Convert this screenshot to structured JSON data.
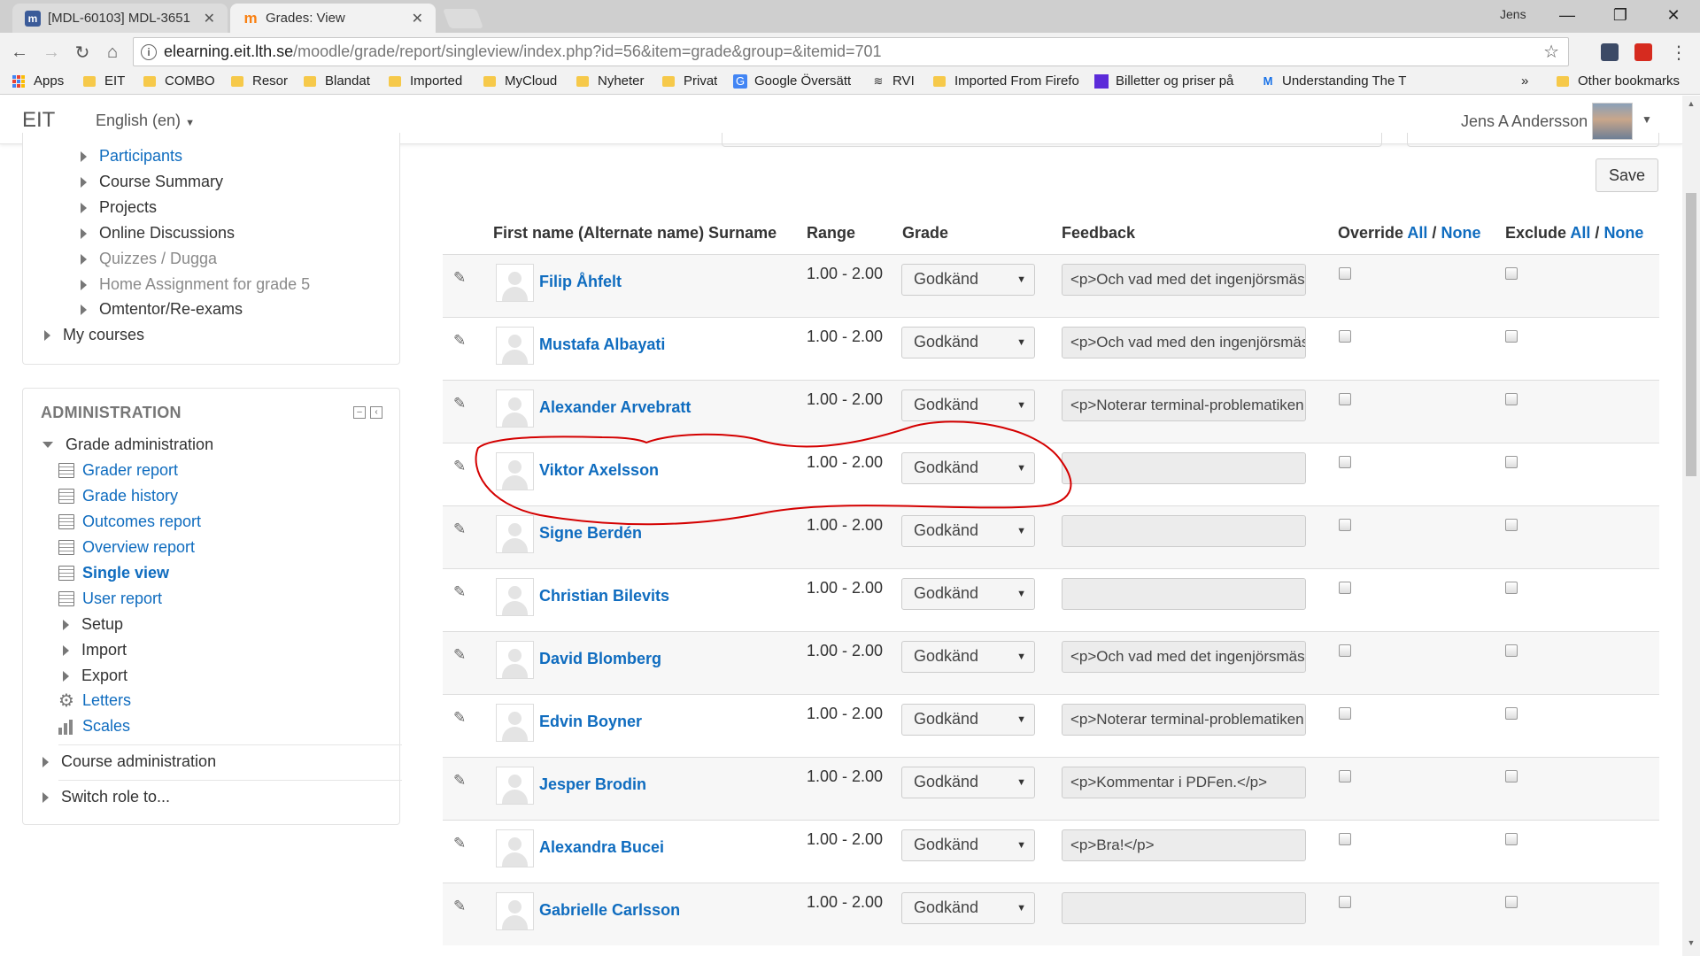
{
  "browser": {
    "tabs": [
      {
        "title": "[MDL-60103] MDL-3651",
        "favicon": "moodle-tracker-icon"
      },
      {
        "title": "Grades: View",
        "favicon": "moodle-icon"
      }
    ],
    "profile": "Jens",
    "url": {
      "host": "elearning.eit.lth.se",
      "path": "/moodle/grade/report/singleview/index.php?id=56&item=grade&group=&itemid=701"
    },
    "bookmarks": [
      "Apps",
      "EIT",
      "COMBO",
      "Resor",
      "Blandat",
      "Imported",
      "MyCloud",
      "Nyheter",
      "Privat",
      "Google Översätt",
      "RVI",
      "Imported From Firefo",
      "Billetter og priser på",
      "Understanding The T"
    ],
    "bookmarks_overflow": "»",
    "other_bookmarks": "Other bookmarks"
  },
  "navbar": {
    "brand": "EIT",
    "language": "English (en)",
    "user": "Jens A Andersson"
  },
  "navigation_block": {
    "items": [
      {
        "label": "Participants",
        "style": "link"
      },
      {
        "label": "Course Summary",
        "style": "dark"
      },
      {
        "label": "Projects",
        "style": "dark"
      },
      {
        "label": "Online Discussions",
        "style": "dark"
      },
      {
        "label": "Quizzes / Dugga",
        "style": "muted"
      },
      {
        "label": "Home Assignment for grade 5",
        "style": "muted"
      },
      {
        "label": "Omtentor/Re-exams",
        "style": "dark"
      }
    ],
    "my_courses": "My courses"
  },
  "admin_block": {
    "title": "ADMINISTRATION",
    "grade_admin": "Grade administration",
    "reports": [
      {
        "label": "Grader report",
        "bold": false
      },
      {
        "label": "Grade history",
        "bold": false
      },
      {
        "label": "Outcomes report",
        "bold": false
      },
      {
        "label": "Overview report",
        "bold": false
      },
      {
        "label": "Single view",
        "bold": true
      },
      {
        "label": "User report",
        "bold": false
      }
    ],
    "subsections": [
      "Setup",
      "Import",
      "Export"
    ],
    "letters": "Letters",
    "scales": "Scales",
    "course_admin": "Course administration",
    "switch_role": "Switch role to..."
  },
  "grades": {
    "save_label": "Save",
    "columns": {
      "name": "First name (Alternate name) Surname",
      "range": "Range",
      "grade": "Grade",
      "feedback": "Feedback",
      "override": "Override",
      "exclude": "Exclude",
      "all": "All",
      "none": "None",
      "sep": "/"
    },
    "rows": [
      {
        "name": "Filip Åhfelt",
        "range": "1.00 - 2.00",
        "grade": "Godkänd",
        "feedback": "<p>Och vad med det ingenjörsmässiga"
      },
      {
        "name": "Mustafa Albayati",
        "range": "1.00 - 2.00",
        "grade": "Godkänd",
        "feedback": "<p>Och vad med den ingenjörsmässiga"
      },
      {
        "name": "Alexander Arvebratt",
        "range": "1.00 - 2.00",
        "grade": "Godkänd",
        "feedback": "<p>Noterar terminal-problematiken"
      },
      {
        "name": "Viktor Axelsson",
        "range": "1.00 - 2.00",
        "grade": "Godkänd",
        "feedback": ""
      },
      {
        "name": "Signe Berdén",
        "range": "1.00 - 2.00",
        "grade": "Godkänd",
        "feedback": ""
      },
      {
        "name": "Christian Bilevits",
        "range": "1.00 - 2.00",
        "grade": "Godkänd",
        "feedback": ""
      },
      {
        "name": "David Blomberg",
        "range": "1.00 - 2.00",
        "grade": "Godkänd",
        "feedback": "<p>Och vad med det ingenjörsmässiga"
      },
      {
        "name": "Edvin Boyner",
        "range": "1.00 - 2.00",
        "grade": "Godkänd",
        "feedback": "<p>Noterar terminal-problematiken"
      },
      {
        "name": "Jesper Brodin",
        "range": "1.00 - 2.00",
        "grade": "Godkänd",
        "feedback": "<p>Kommentar i PDFen.</p>"
      },
      {
        "name": "Alexandra Bucei",
        "range": "1.00 - 2.00",
        "grade": "Godkänd",
        "feedback": "<p>Bra!</p>"
      },
      {
        "name": "Gabrielle Carlsson",
        "range": "1.00 - 2.00",
        "grade": "Godkänd",
        "feedback": ""
      }
    ]
  },
  "colors": {
    "link": "#0f6cbf",
    "annotation": "#d40000",
    "folder": "#f6c94a"
  }
}
